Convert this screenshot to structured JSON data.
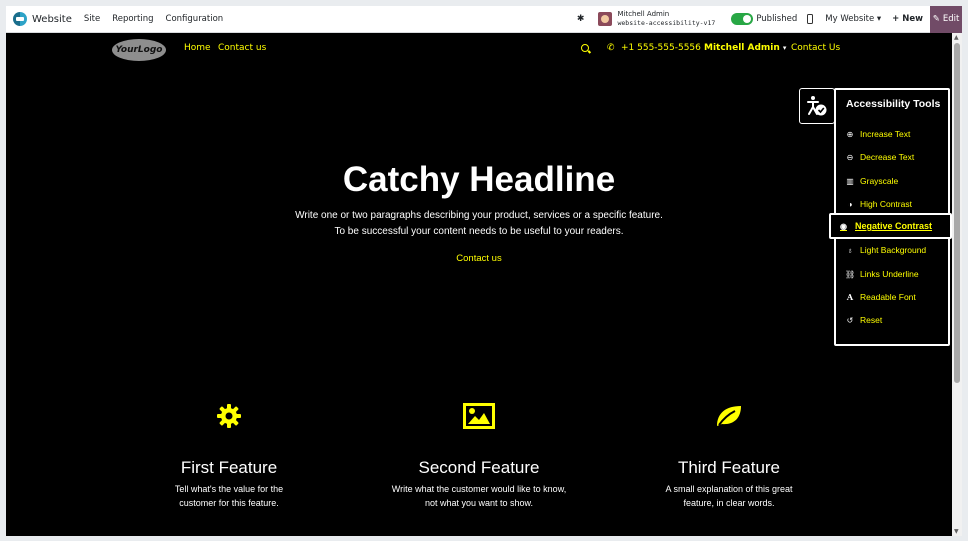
{
  "topbar": {
    "app_name": "Website",
    "menus": [
      "Site",
      "Reporting",
      "Configuration"
    ],
    "user_name": "Mitchell Admin",
    "database": "website-accessibility-v17",
    "published_label": "Published",
    "site_selector": "My Website",
    "new_label": "New",
    "edit_label": "Edit"
  },
  "nav": {
    "logo_text": "YourLogo",
    "links": [
      "Home",
      "Contact us"
    ],
    "phone": "+1 555-555-5556",
    "user": "Mitchell Admin",
    "cta": "Contact Us"
  },
  "hero": {
    "title": "Catchy Headline",
    "line1": "Write one or two paragraphs describing your product, services or a specific feature.",
    "line2": "To be successful your content needs to be useful to your readers.",
    "cta": "Contact us"
  },
  "features": [
    {
      "icon": "gear-icon",
      "title": "First Feature",
      "desc1": "Tell what's the value for the",
      "desc2": "customer for this feature."
    },
    {
      "icon": "image-icon",
      "title": "Second Feature",
      "desc1": "Write what the customer would like to know,",
      "desc2": "not what you want to show."
    },
    {
      "icon": "leaf-icon",
      "title": "Third Feature",
      "desc1": "A small explanation of this great",
      "desc2": "feature, in clear words."
    }
  ],
  "accessibility": {
    "title": "Accessibility Tools",
    "items": [
      {
        "label": "Increase Text",
        "icon": "zoom-in-icon"
      },
      {
        "label": "Decrease Text",
        "icon": "zoom-out-icon"
      },
      {
        "label": "Grayscale",
        "icon": "grayscale-icon"
      },
      {
        "label": "High Contrast",
        "icon": "contrast-icon"
      },
      {
        "label": "Negative Contrast",
        "icon": "eye-icon",
        "active": true
      },
      {
        "label": "Light Background",
        "icon": "bulb-icon"
      },
      {
        "label": "Links Underline",
        "icon": "link-icon"
      },
      {
        "label": "Readable Font",
        "icon": "font-icon"
      },
      {
        "label": "Reset",
        "icon": "reset-icon"
      }
    ]
  },
  "colors": {
    "link": "#ffff00",
    "background": "#000000",
    "edit_button": "#714b67",
    "published_toggle": "#28a745"
  }
}
